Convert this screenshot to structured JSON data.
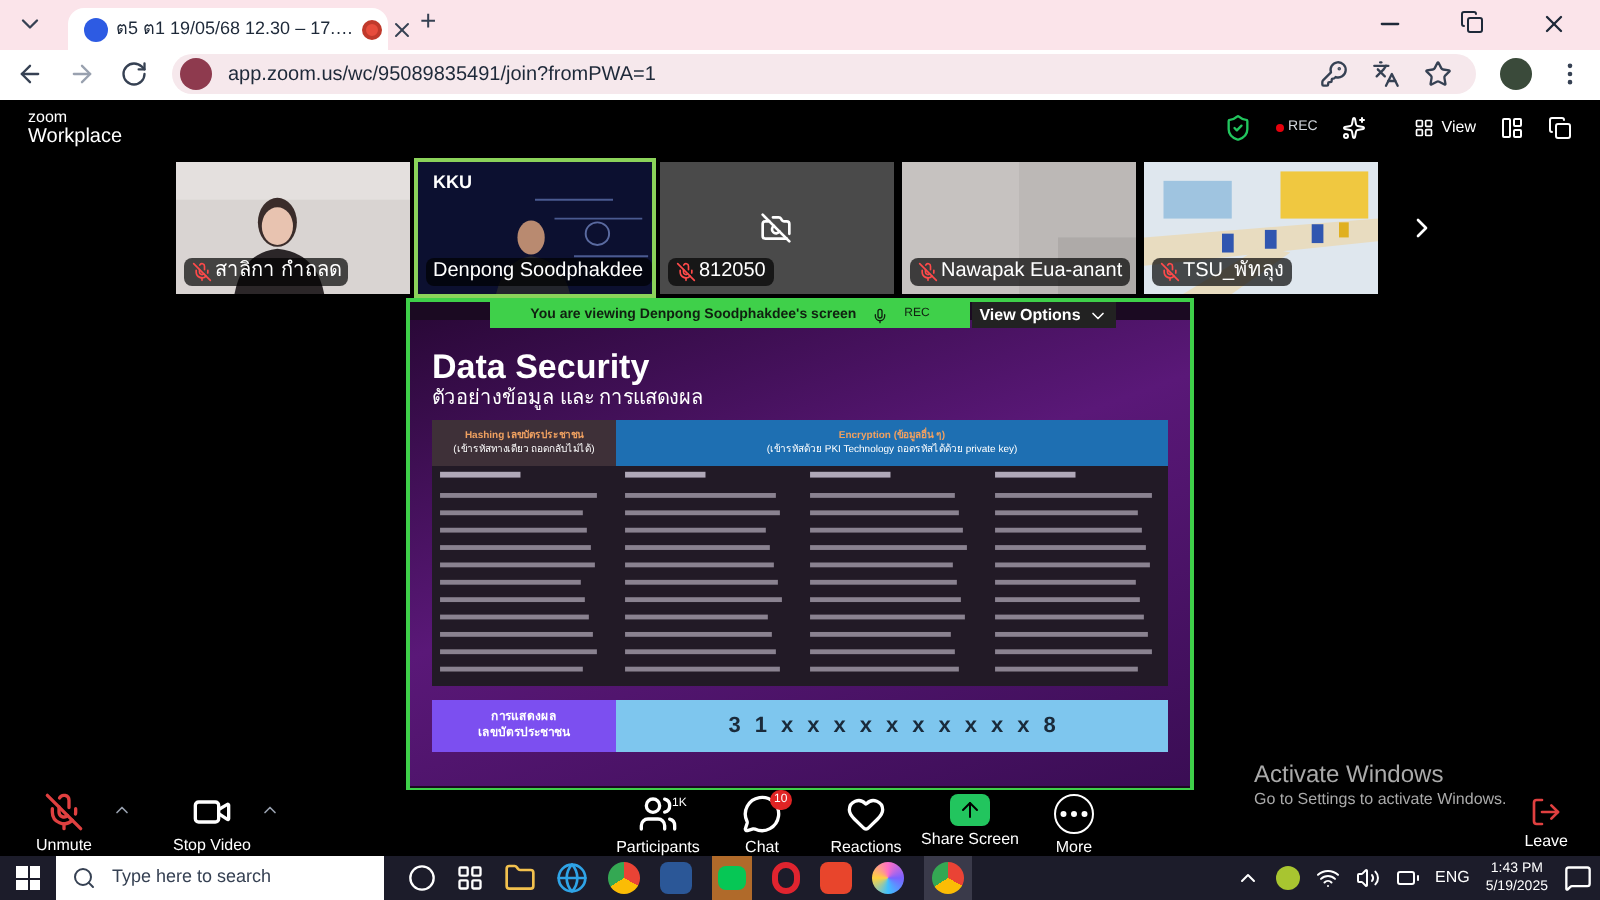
{
  "browser": {
    "tab_title": "ต5 ต1 19/05/68 12.30 – 17.…",
    "tab_recording": true,
    "new_tab": "+",
    "url": "app.zoom.us/wc/95089835491/join?fromPWA=1"
  },
  "zoom_header": {
    "logo_top": "zoom",
    "logo_bottom": "Workplace",
    "rec": "REC",
    "view": "View"
  },
  "participants": [
    {
      "name": "สาลิกา กำถลด",
      "kind": "picture",
      "muted": true,
      "active": false
    },
    {
      "name": "Denpong Soodphakdee",
      "kind": "presenter",
      "muted": false,
      "active": true,
      "badge": "KKU"
    },
    {
      "name": "812050",
      "kind": "camera_off",
      "muted": true,
      "active": false
    },
    {
      "name": "Nawapak Eua-anant",
      "kind": "wall",
      "muted": true,
      "active": false
    },
    {
      "name": "TSU_พัทลุง",
      "kind": "room",
      "muted": true,
      "active": false
    }
  ],
  "share_banner": {
    "text": "You are viewing  Denpong Soodphakdee's screen",
    "rec": "REC",
    "view_options": "View Options"
  },
  "slide": {
    "title": "Data Security",
    "subtitle": "ตัวอย่างข้อมูล และ การแสดงผล",
    "hash_header": {
      "title": "Hashing เลขบัตรประชาชน",
      "note": "(เข้ารหัสทางเดียว ถอดกลับไม่ได้)"
    },
    "enc_header": {
      "title": "Encryption (ข้อมูลอื่น ๆ)",
      "note": "(เข้ารหัสด้วย PKI Technology ถอดรหัสได้ด้วย private key)"
    },
    "display_label": [
      "การแสดงผล",
      "เลขบัตรประชาชน"
    ],
    "display_value": [
      "3",
      "1",
      "x",
      "x",
      "x",
      "x",
      "x",
      "x",
      "x",
      "x",
      "x",
      "x",
      "8"
    ]
  },
  "watermark_note": {
    "line1": "Activate Windows",
    "line2": "Go to Settings to activate Windows."
  },
  "toolbar": {
    "left": [
      {
        "label": "Unmute",
        "kind": "mic"
      },
      {
        "label": "Stop Video",
        "kind": "video"
      }
    ],
    "center": [
      {
        "label": "Participants",
        "kind": "people",
        "badge": "1K"
      },
      {
        "label": "Chat",
        "kind": "chat",
        "badge": "10"
      },
      {
        "label": "Reactions",
        "kind": "heart"
      },
      {
        "label": "Share Screen",
        "kind": "share"
      },
      {
        "label": "More",
        "kind": "more"
      }
    ],
    "leave": "Leave"
  },
  "taskbar": {
    "search_placeholder": "Type here to search",
    "language": "ENG",
    "time": "1:43 PM",
    "date": "5/19/2025"
  }
}
